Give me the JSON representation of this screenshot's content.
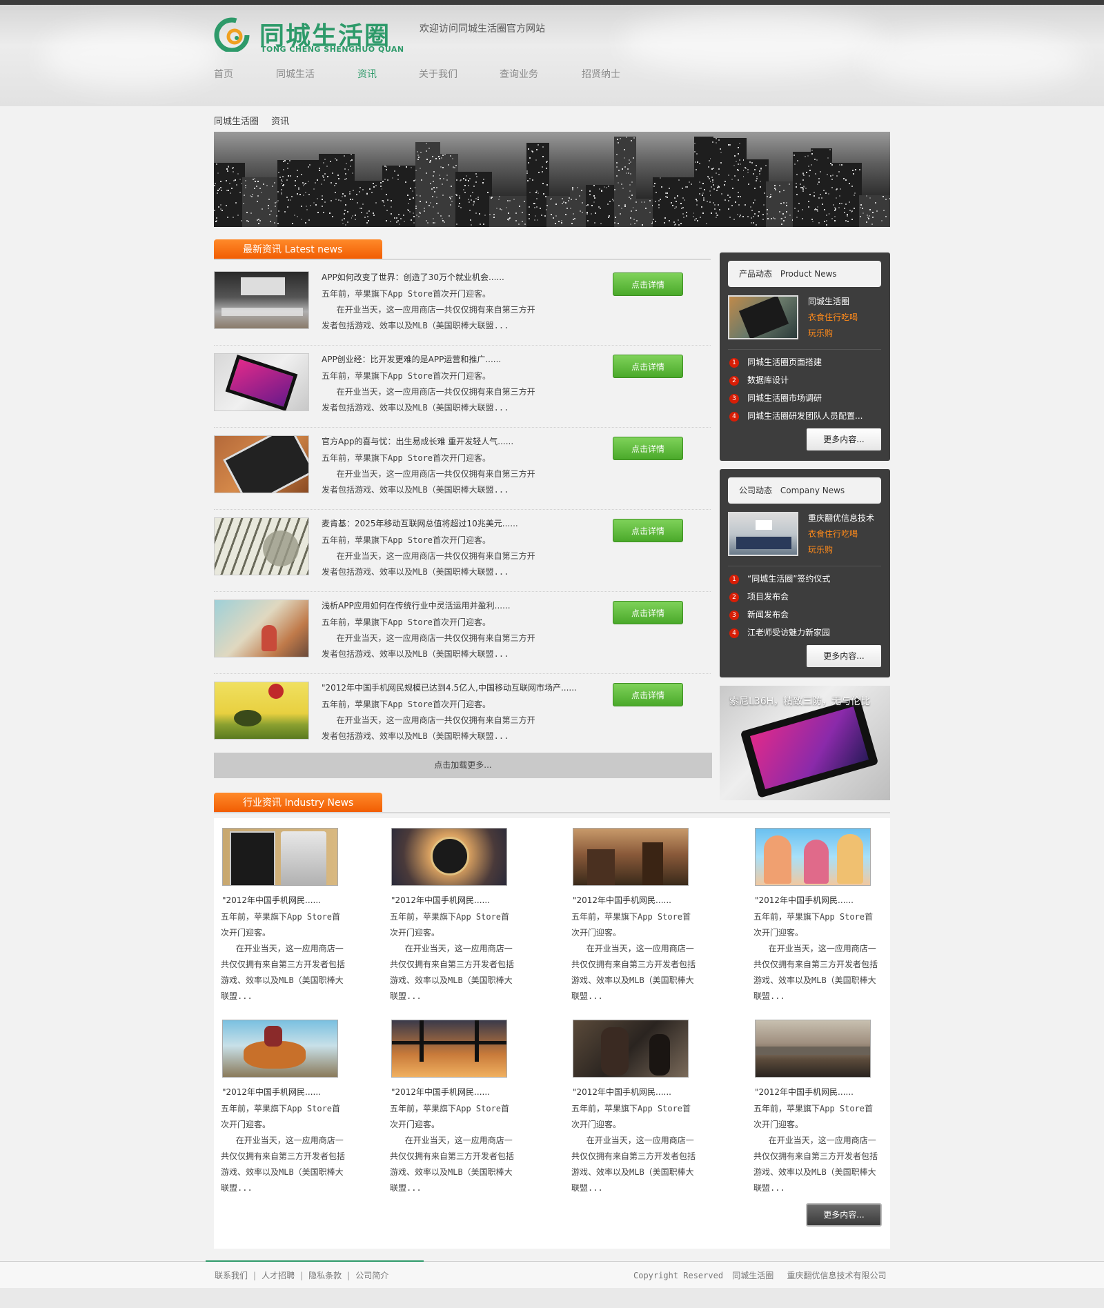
{
  "header": {
    "logo_cn": "同城生活圈",
    "logo_en": "TONG CHENG SHENGHUO QUAN",
    "welcome": "欢迎访问同城生活圈官方网站",
    "nav": [
      {
        "label": "首页"
      },
      {
        "label": "同城生活"
      },
      {
        "label": "资讯",
        "active": true
      },
      {
        "label": "关于我们"
      },
      {
        "label": "查询业务"
      },
      {
        "label": "招贤纳士"
      }
    ]
  },
  "breadcrumb": [
    "同城生活圈",
    "资讯"
  ],
  "latest": {
    "title": "最新资讯   Latest news",
    "detail_label": "点击详情",
    "load_more": "点击加载更多...",
    "items": [
      {
        "title": "APP如何改变了世界：创造了30万个就业机会......",
        "line1": "五年前，苹果旗下App Store首次开门迎客。",
        "line2": "   在开业当天，这一应用商店一共仅仅拥有来自第三方开",
        "line3": "发者包括游戏、效率以及MLB（美国职棒大联盟...",
        "thumb": "apple-store"
      },
      {
        "title": "APP创业经：比开发更难的是APP运营和推广......",
        "line1": "五年前，苹果旗下App Store首次开门迎客。",
        "line2": "   在开业当天，这一应用商店一共仅仅拥有来自第三方开",
        "line3": "发者包括游戏、效率以及MLB（美国职棒大联盟...",
        "thumb": "phone-pink"
      },
      {
        "title": "官方App的喜与忧：出生易成长难 重开发轻人气......",
        "line1": "五年前，苹果旗下App Store首次开门迎客。",
        "line2": "   在开业当天，这一应用商店一共仅仅拥有来自第三方开",
        "line3": "发者包括游戏、效率以及MLB（美国职棒大联盟...",
        "thumb": "tablet-wood"
      },
      {
        "title": "麦肯基：2025年移动互联网总值将超过10兆美元......",
        "line1": "五年前，苹果旗下App Store首次开门迎客。",
        "line2": "   在开业当天，这一应用商店一共仅仅拥有来自第三方开",
        "line3": "发者包括游戏、效率以及MLB（美国职棒大联盟...",
        "thumb": "dollars"
      },
      {
        "title": "浅析APP应用如何在传统行业中灵活运用并盈利......",
        "line1": "五年前，苹果旗下App Store首次开门迎客。",
        "line2": "   在开业当天，这一应用商店一共仅仅拥有来自第三方开",
        "line3": "发者包括游戏、效率以及MLB（美国职棒大联盟...",
        "thumb": "painting"
      },
      {
        "title": "\"2012年中国手机网民规模已达到4.5亿人,中国移动互联网市场产......",
        "line1": "五年前，苹果旗下App Store首次开门迎客。",
        "line2": "   在开业当天，这一应用商店一共仅仅拥有来自第三方开",
        "line3": "发者包括游戏、效率以及MLB（美国职棒大联盟...",
        "thumb": "balloon"
      }
    ]
  },
  "product_news": {
    "title_cn": "产品动态",
    "title_en": "Product News",
    "feature": {
      "line1": "同城生活圈",
      "line2": "衣食住行吃喝",
      "line3": "玩乐购"
    },
    "items": [
      "同城生活圈页面搭建",
      "数据库设计",
      "同城生活圈市场调研",
      "同城生活圈研发团队人员配置..."
    ],
    "more": "更多内容..."
  },
  "company_news": {
    "title_cn": "公司动态",
    "title_en": "Company News",
    "feature": {
      "line1": "重庆翻优信息技术",
      "line2": "衣食住行吃喝",
      "line3": "玩乐购"
    },
    "items": [
      "“同城生活圈”签约仪式",
      "项目发布会",
      "新闻发布会",
      "江老师受访魅力新家园"
    ],
    "more": "更多内容..."
  },
  "ad": {
    "text": "索尼L36H，精致三防，无与伦比"
  },
  "industry": {
    "title": "行业资讯   Industry News",
    "more": "更多内容...",
    "cards": [
      {
        "title": "\"2012年中国手机网民......",
        "body": "五年前，苹果旗下App Store首次开门迎客。\n   在开业当天，这一应用商店一共仅仅拥有来自第三方开发者包括游戏、效率以及MLB（美国职棒大联盟...",
        "thumb": "iphone"
      },
      {
        "title": "\"2012年中国手机网民......",
        "body": "五年前，苹果旗下App Store首次开门迎客。\n   在开业当天，这一应用商店一共仅仅拥有来自第三方开发者包括游戏、效率以及MLB（美国职棒大联盟...",
        "thumb": "lamp"
      },
      {
        "title": "\"2012年中国手机网民......",
        "body": "五年前，苹果旗下App Store首次开门迎客。\n   在开业当天，这一应用商店一共仅仅拥有来自第三方开发者包括游戏、效率以及MLB（美国职棒大联盟...",
        "thumb": "ruins"
      },
      {
        "title": "\"2012年中国手机网民......",
        "body": "五年前，苹果旗下App Store首次开门迎客。\n   在开业当天，这一应用商店一共仅仅拥有来自第三方开发者包括游戏、效率以及MLB（美国职棒大联盟...",
        "thumb": "anime"
      },
      {
        "title": "\"2012年中国手机网民......",
        "body": "五年前，苹果旗下App Store首次开门迎客。\n   在开业当天，这一应用商店一共仅仅拥有来自第三方开发者包括游戏、效率以及MLB（美国职棒大联盟...",
        "thumb": "tiger"
      },
      {
        "title": "\"2012年中国手机网民......",
        "body": "五年前，苹果旗下App Store首次开门迎客。\n   在开业当天，这一应用商店一共仅仅拥有来自第三方开发者包括游戏、效率以及MLB（美国职棒大联盟...",
        "thumb": "bridge"
      },
      {
        "title": "\"2012年中国手机网民......",
        "body": "五年前，苹果旗下App Store首次开门迎客。\n   在开业当天，这一应用商店一共仅仅拥有来自第三方开发者包括游戏、效率以及MLB（美国职棒大联盟...",
        "thumb": "warrior"
      },
      {
        "title": "\"2012年中国手机网民......",
        "body": "五年前，苹果旗下App Store首次开门迎客。\n   在开业当天，这一应用商店一共仅仅拥有来自第三方开发者包括游戏、效率以及MLB（美国职棒大联盟...",
        "thumb": "coast"
      }
    ]
  },
  "footer": {
    "links": [
      "联系我们",
      "人才招聘",
      "隐私条款",
      "公司简介"
    ],
    "separator": "|",
    "copyright_prefix": "Copyright Reserved",
    "copyright_site": "同城生活圈",
    "copyright_company": "重庆翻优信息技术有限公司"
  },
  "colors": {
    "brand_green": "#2e9a6a",
    "accent_orange": "#f05a00",
    "button_green": "#4aa92a",
    "number_red": "#d81e06"
  }
}
